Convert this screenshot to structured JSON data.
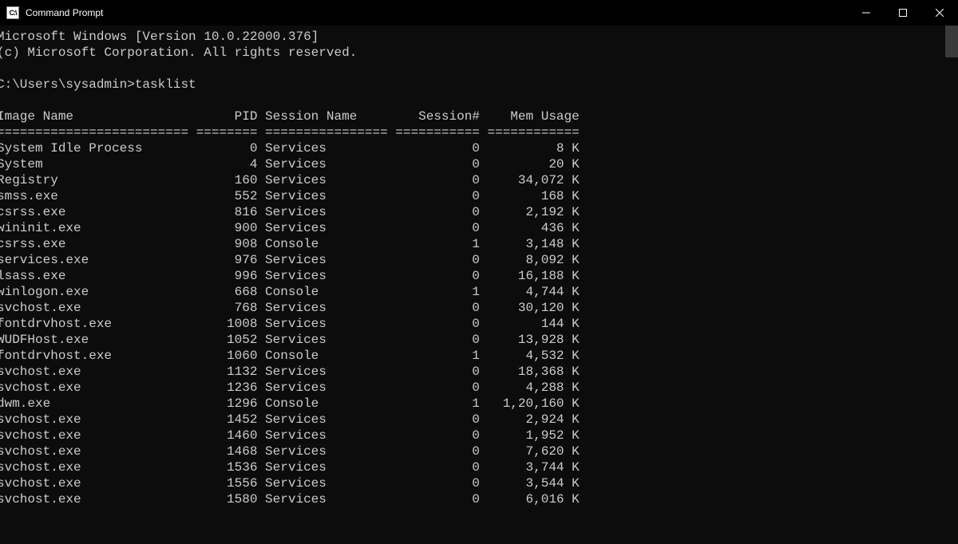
{
  "window": {
    "title": "Command Prompt",
    "icon_label": "C:\\"
  },
  "banner": {
    "line1": "Microsoft Windows [Version 10.0.22000.376]",
    "line2": "(c) Microsoft Corporation. All rights reserved."
  },
  "prompt": {
    "path": "C:\\Users\\sysadmin>",
    "command": "tasklist"
  },
  "columns": {
    "image_name": "Image Name",
    "pid": "PID",
    "session_name": "Session Name",
    "session_num": "Session#",
    "mem_usage": "Mem Usage"
  },
  "separator": {
    "image_name": "=========================",
    "pid": "========",
    "session_name": "================",
    "session_num": "===========",
    "mem_usage": "============"
  },
  "processes": [
    {
      "name": "System Idle Process",
      "pid": "0",
      "session_name": "Services",
      "session_num": "0",
      "mem": "8 K"
    },
    {
      "name": "System",
      "pid": "4",
      "session_name": "Services",
      "session_num": "0",
      "mem": "20 K"
    },
    {
      "name": "Registry",
      "pid": "160",
      "session_name": "Services",
      "session_num": "0",
      "mem": "34,072 K"
    },
    {
      "name": "smss.exe",
      "pid": "552",
      "session_name": "Services",
      "session_num": "0",
      "mem": "168 K"
    },
    {
      "name": "csrss.exe",
      "pid": "816",
      "session_name": "Services",
      "session_num": "0",
      "mem": "2,192 K"
    },
    {
      "name": "wininit.exe",
      "pid": "900",
      "session_name": "Services",
      "session_num": "0",
      "mem": "436 K"
    },
    {
      "name": "csrss.exe",
      "pid": "908",
      "session_name": "Console",
      "session_num": "1",
      "mem": "3,148 K"
    },
    {
      "name": "services.exe",
      "pid": "976",
      "session_name": "Services",
      "session_num": "0",
      "mem": "8,092 K"
    },
    {
      "name": "lsass.exe",
      "pid": "996",
      "session_name": "Services",
      "session_num": "0",
      "mem": "16,188 K"
    },
    {
      "name": "winlogon.exe",
      "pid": "668",
      "session_name": "Console",
      "session_num": "1",
      "mem": "4,744 K"
    },
    {
      "name": "svchost.exe",
      "pid": "768",
      "session_name": "Services",
      "session_num": "0",
      "mem": "30,120 K"
    },
    {
      "name": "fontdrvhost.exe",
      "pid": "1008",
      "session_name": "Services",
      "session_num": "0",
      "mem": "144 K"
    },
    {
      "name": "WUDFHost.exe",
      "pid": "1052",
      "session_name": "Services",
      "session_num": "0",
      "mem": "13,928 K"
    },
    {
      "name": "fontdrvhost.exe",
      "pid": "1060",
      "session_name": "Console",
      "session_num": "1",
      "mem": "4,532 K"
    },
    {
      "name": "svchost.exe",
      "pid": "1132",
      "session_name": "Services",
      "session_num": "0",
      "mem": "18,368 K"
    },
    {
      "name": "svchost.exe",
      "pid": "1236",
      "session_name": "Services",
      "session_num": "0",
      "mem": "4,288 K"
    },
    {
      "name": "dwm.exe",
      "pid": "1296",
      "session_name": "Console",
      "session_num": "1",
      "mem": "1,20,160 K"
    },
    {
      "name": "svchost.exe",
      "pid": "1452",
      "session_name": "Services",
      "session_num": "0",
      "mem": "2,924 K"
    },
    {
      "name": "svchost.exe",
      "pid": "1460",
      "session_name": "Services",
      "session_num": "0",
      "mem": "1,952 K"
    },
    {
      "name": "svchost.exe",
      "pid": "1468",
      "session_name": "Services",
      "session_num": "0",
      "mem": "7,620 K"
    },
    {
      "name": "svchost.exe",
      "pid": "1536",
      "session_name": "Services",
      "session_num": "0",
      "mem": "3,744 K"
    },
    {
      "name": "svchost.exe",
      "pid": "1556",
      "session_name": "Services",
      "session_num": "0",
      "mem": "3,544 K"
    },
    {
      "name": "svchost.exe",
      "pid": "1580",
      "session_name": "Services",
      "session_num": "0",
      "mem": "6,016 K"
    }
  ]
}
